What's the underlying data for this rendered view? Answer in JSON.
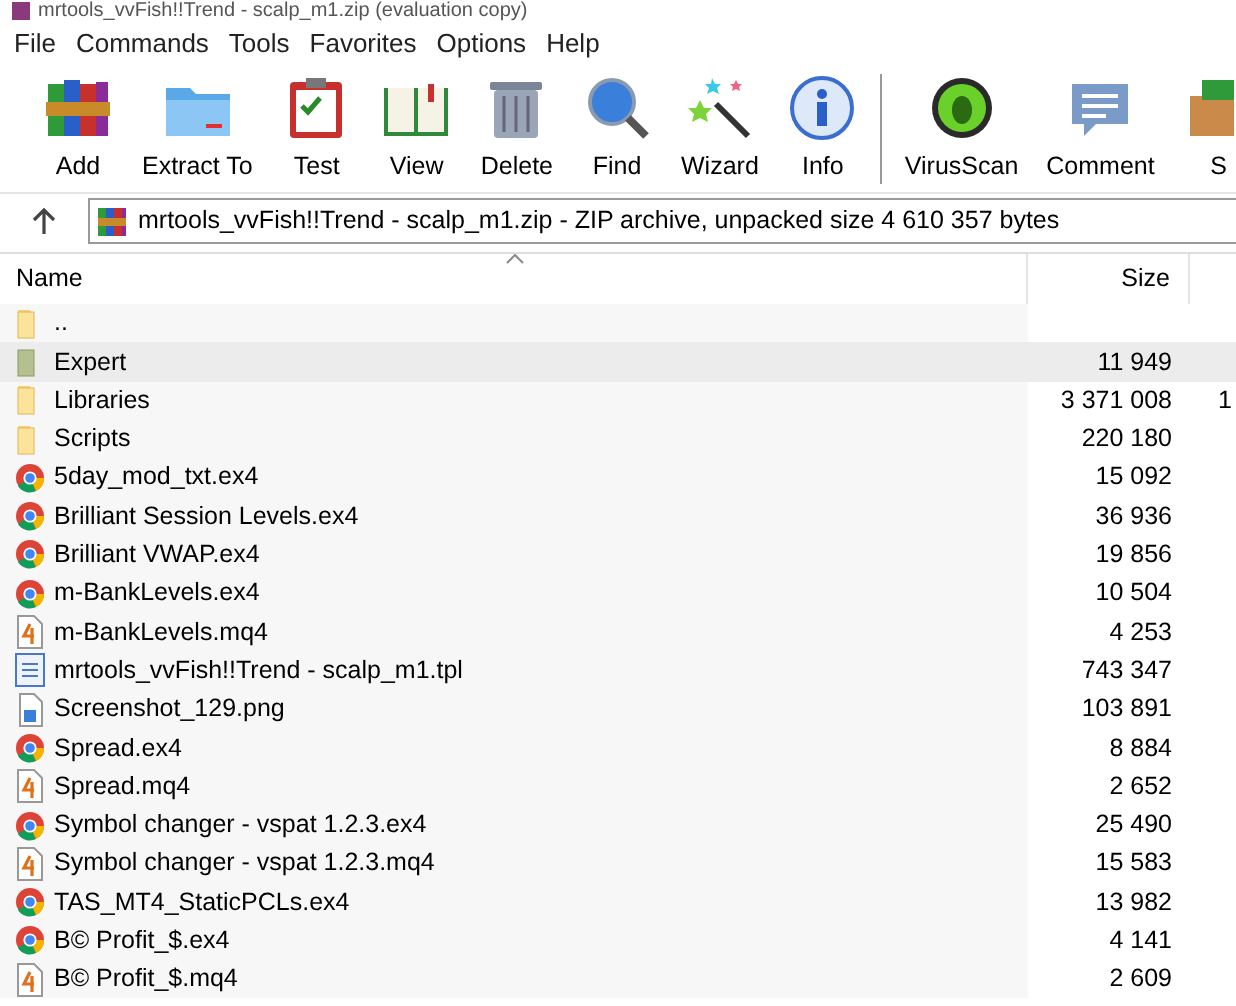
{
  "window": {
    "title": "mrtools_vvFish!!Trend - scalp_m1.zip (evaluation copy)"
  },
  "menu": [
    "File",
    "Commands",
    "Tools",
    "Favorites",
    "Options",
    "Help"
  ],
  "toolbar": [
    {
      "label": "Add",
      "kind": "books"
    },
    {
      "label": "Extract To",
      "kind": "folder"
    },
    {
      "label": "Test",
      "kind": "clipboard"
    },
    {
      "label": "View",
      "kind": "book"
    },
    {
      "label": "Delete",
      "kind": "trash"
    },
    {
      "label": "Find",
      "kind": "magnifier"
    },
    {
      "label": "Wizard",
      "kind": "wand"
    },
    {
      "label": "Info",
      "kind": "info"
    },
    {
      "label": "VirusScan",
      "kind": "bug",
      "separator_before": true
    },
    {
      "label": "Comment",
      "kind": "comment"
    },
    {
      "label": "S",
      "kind": "box"
    }
  ],
  "address": {
    "text": "mrtools_vvFish!!Trend - scalp_m1.zip - ZIP archive, unpacked size 4 610 357 bytes"
  },
  "table": {
    "columns": [
      "Name",
      "Size"
    ],
    "rows": [
      {
        "name": "..",
        "kind": "folder",
        "selected": false
      },
      {
        "name": "Expert",
        "size": "11 949",
        "kind": "shaded-folder",
        "selected": true
      },
      {
        "name": "Libraries",
        "size": "3 371 008",
        "column_3": "1",
        "kind": "folder",
        "selected": false
      },
      {
        "name": "Scripts",
        "size": "220 180",
        "kind": "folder",
        "selected": false
      },
      {
        "name": "5day_mod_txt.ex4",
        "size": "15 092",
        "kind": "circle",
        "selected": false
      },
      {
        "name": "Brilliant Session Levels.ex4",
        "size": "36 936",
        "kind": "circle",
        "selected": false
      },
      {
        "name": "Brilliant VWAP.ex4",
        "size": "19 856",
        "kind": "circle",
        "selected": false
      },
      {
        "name": "m-BankLevels.ex4",
        "size": "10 504",
        "kind": "circle",
        "selected": false
      },
      {
        "name": "m-BankLevels.mq4",
        "size": "4 253",
        "kind": "script",
        "selected": false
      },
      {
        "name": "mrtools_vvFish!!Trend - scalp_m1.tpl",
        "size": "743 347",
        "kind": "template",
        "selected": false
      },
      {
        "name": "Screenshot_129.png",
        "size": "103 891",
        "kind": "image",
        "selected": false
      },
      {
        "name": "Spread.ex4",
        "size": "8 884",
        "kind": "circle",
        "selected": false
      },
      {
        "name": "Spread.mq4",
        "size": "2 652",
        "kind": "script",
        "selected": false
      },
      {
        "name": "Symbol changer - vspat 1.2.3.ex4",
        "size": "25 490",
        "kind": "circle",
        "selected": false
      },
      {
        "name": "Symbol changer - vspat 1.2.3.mq4",
        "size": "15 583",
        "kind": "script",
        "selected": false
      },
      {
        "name": "TAS_MT4_StaticPCLs.ex4",
        "size": "13 982",
        "kind": "circle",
        "selected": false
      },
      {
        "name": "B© Profit_$.ex4",
        "size": "4 141",
        "kind": "circle",
        "selected": false
      },
      {
        "name": "B© Profit_$.mq4",
        "size": "2 609",
        "kind": "script",
        "selected": false
      }
    ]
  }
}
